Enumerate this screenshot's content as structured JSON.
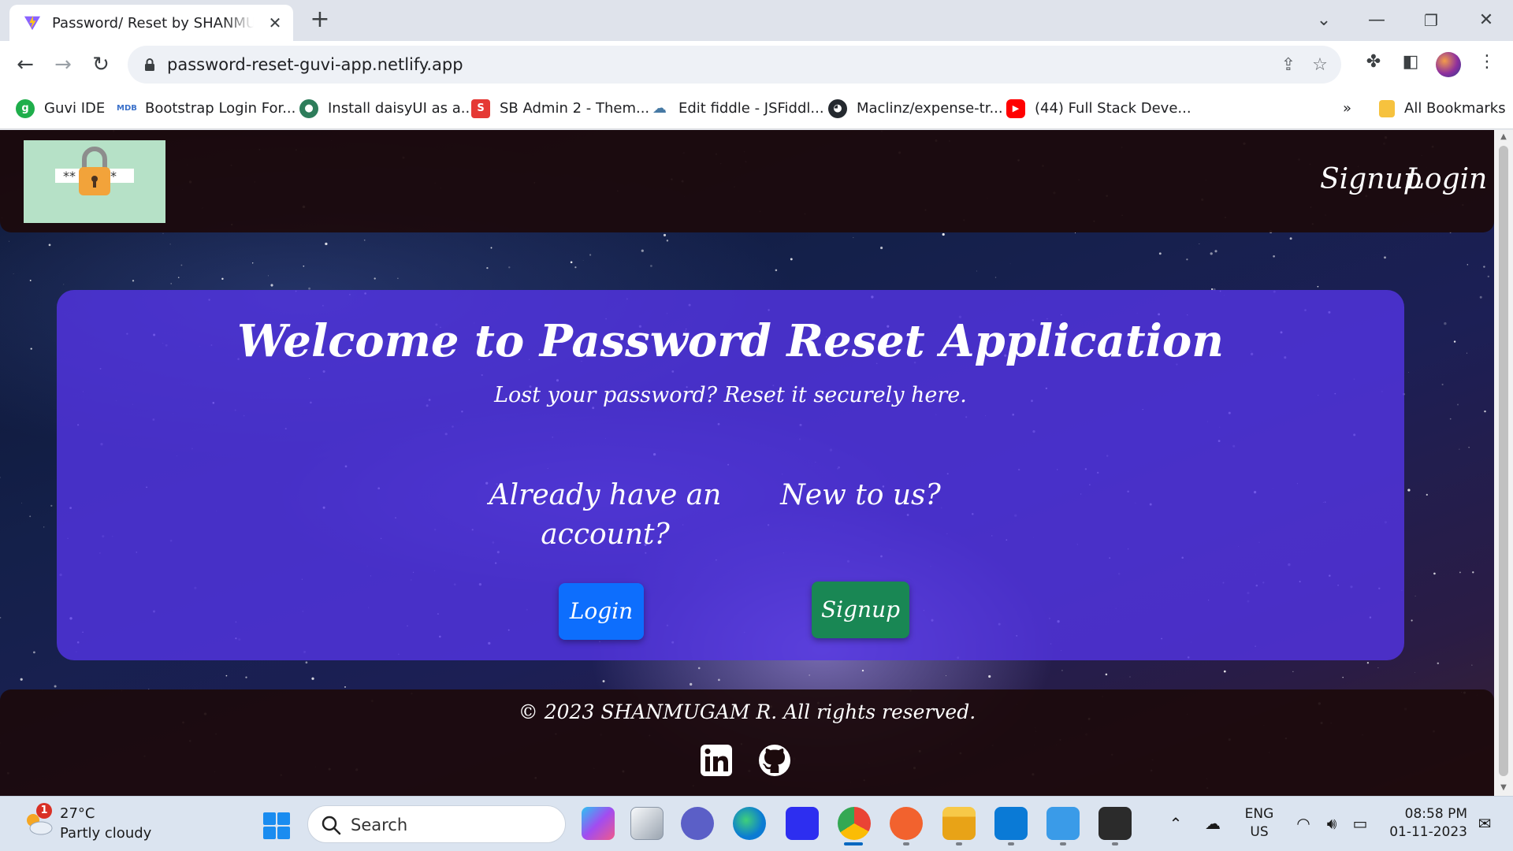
{
  "browser": {
    "tab_title": "Password/ Reset by SHANMUGAM R",
    "url": "password-reset-guvi-app.netlify.app",
    "bookmarks": [
      {
        "label": "Guvi IDE",
        "icon": "guvi-icon",
        "color": "#1fae4b"
      },
      {
        "label": "Bootstrap Login For...",
        "icon": "mdb-icon",
        "color": "#3b71ca"
      },
      {
        "label": "Install daisyUI as a...",
        "icon": "daisyui-icon",
        "color": "#2e7d5b"
      },
      {
        "label": "SB Admin 2 - Them...",
        "icon": "sb-icon",
        "color": "#e53935"
      },
      {
        "label": "Edit fiddle - JSFiddl...",
        "icon": "jsfiddle-icon",
        "color": "#4679a4"
      },
      {
        "label": "Maclinz/expense-tr...",
        "icon": "github-icon",
        "color": "#24292f"
      },
      {
        "label": "(44) Full Stack Deve...",
        "icon": "youtube-icon",
        "color": "#ff0000"
      }
    ],
    "all_bookmarks": "All Bookmarks"
  },
  "page": {
    "nav": {
      "signup": "Signup",
      "login": "Login"
    },
    "hero": {
      "title": "Welcome to Password Reset Application",
      "subtitle": "Lost your password? Reset it securely here.",
      "existing_line1": "Already have an",
      "existing_line2": "account?",
      "new_user": "New to us?",
      "login_button": "Login",
      "signup_button": "Signup"
    },
    "footer": {
      "copyright": "© 2023 SHANMUGAM R. All rights reserved."
    },
    "logo_text": "** *"
  },
  "taskbar": {
    "weather": {
      "temp": "27°C",
      "condition": "Partly cloudy",
      "badge": "1"
    },
    "search_placeholder": "Search",
    "language": {
      "line1": "ENG",
      "line2": "US"
    },
    "time": "08:58 PM",
    "date": "01-11-2023"
  },
  "colors": {
    "login_button": "#0d6efd",
    "signup_button": "#198754",
    "hero_panel": "#5434e6"
  }
}
